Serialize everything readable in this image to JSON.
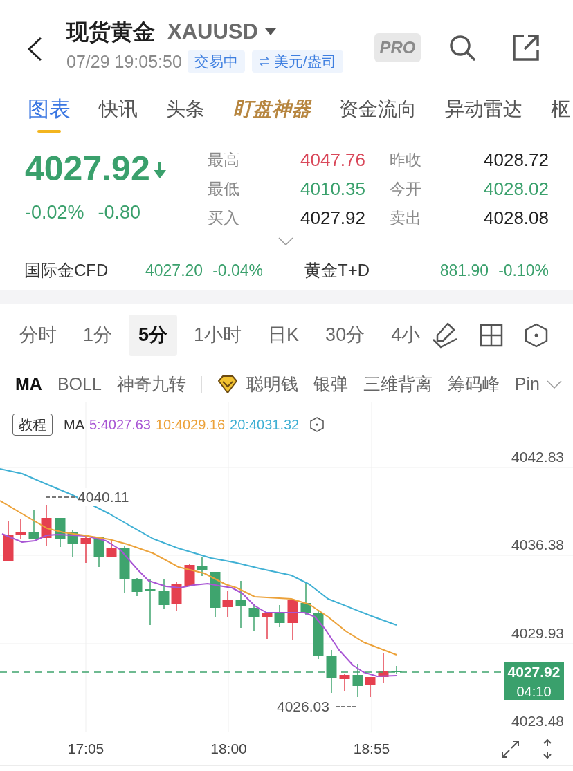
{
  "header": {
    "title": "现货黄金",
    "symbol": "XAUUSD",
    "datetime": "07/29 19:05:50",
    "status_badge": "交易中",
    "unit_badge": "美元/盎司",
    "pro_badge": "PRO"
  },
  "tabs": [
    {
      "label": "图表",
      "selected": true,
      "kind": "normal"
    },
    {
      "label": "快讯",
      "selected": false,
      "kind": "normal"
    },
    {
      "label": "头条",
      "selected": false,
      "kind": "normal"
    },
    {
      "label": "盯盘神器",
      "selected": false,
      "kind": "featured"
    },
    {
      "label": "资金流向",
      "selected": false,
      "kind": "normal"
    },
    {
      "label": "异动雷达",
      "selected": false,
      "kind": "normal"
    },
    {
      "label": "枢",
      "selected": false,
      "kind": "normal"
    }
  ],
  "quote": {
    "price": "4027.92",
    "falling": true,
    "change_percent": "-0.02%",
    "change": "-0.80",
    "stats": [
      {
        "label": "最高",
        "value": "4047.76",
        "color": "#d9485a"
      },
      {
        "label": "昨收",
        "value": "4028.72",
        "color": "#222222"
      },
      {
        "label": "最低",
        "value": "4010.35",
        "color": "#3aa06c"
      },
      {
        "label": "今开",
        "value": "4028.02",
        "color": "#3aa06c"
      },
      {
        "label": "买入",
        "value": "4027.92",
        "color": "#222222"
      },
      {
        "label": "卖出",
        "value": "4028.08",
        "color": "#222222"
      }
    ]
  },
  "related_markets": [
    {
      "name": "国际金CFD",
      "price": "4027.20",
      "change": "-0.04%",
      "falling": true
    },
    {
      "name": "黄金T+D",
      "price": "881.90",
      "change": "-0.10%",
      "falling": true
    }
  ],
  "periods": [
    {
      "label": "分时",
      "selected": false
    },
    {
      "label": "1分",
      "selected": false
    },
    {
      "label": "5分",
      "selected": true
    },
    {
      "label": "1小时",
      "selected": false
    },
    {
      "label": "日K",
      "selected": false
    },
    {
      "label": "30分",
      "selected": false
    },
    {
      "label": "4小",
      "selected": false
    }
  ],
  "indicators": [
    {
      "label": "MA",
      "selected": true,
      "kind": "basic"
    },
    {
      "label": "BOLL",
      "selected": false,
      "kind": "basic"
    },
    {
      "label": "神奇九转",
      "selected": false,
      "kind": "basic"
    },
    {
      "label": "聪明钱",
      "selected": false,
      "kind": "premium"
    },
    {
      "label": "银弹",
      "selected": false,
      "kind": "basic"
    },
    {
      "label": "三维背离",
      "selected": false,
      "kind": "basic"
    },
    {
      "label": "筹码峰",
      "selected": false,
      "kind": "basic"
    },
    {
      "label": "Pin",
      "selected": false,
      "kind": "basic"
    }
  ],
  "chart": {
    "tutorial_button": "教程",
    "ma_label": "MA",
    "ma_values": [
      {
        "text": "5:4027.63",
        "color": "#a855d4"
      },
      {
        "text": "10:4029.16",
        "color": "#eca23a"
      },
      {
        "text": "20:4031.32",
        "color": "#3fb0d4"
      }
    ],
    "y_axis_labels": [
      "4042.83",
      "4036.38",
      "4029.93",
      "4023.48"
    ],
    "high_marker": "4040.11",
    "low_marker": "4026.03",
    "last_price": "4027.92",
    "countdown": "04:10",
    "x_axis_labels": [
      "17:05",
      "18:00",
      "18:55"
    ]
  }
}
